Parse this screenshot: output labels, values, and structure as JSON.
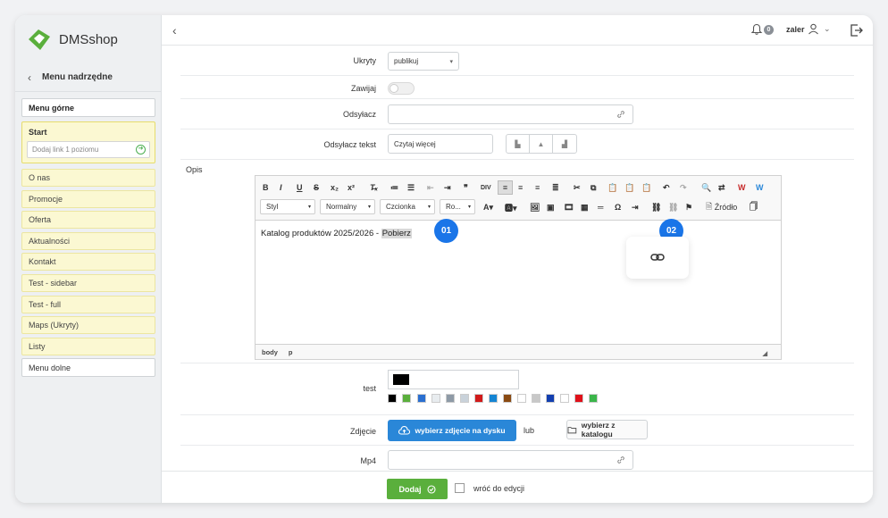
{
  "brand": {
    "name": "DMSshop"
  },
  "sidebar": {
    "parent_menu": "Menu nadrzędne",
    "top_menu": "Menu górne",
    "start": {
      "title": "Start",
      "placeholder": "Dodaj link 1 poziomu"
    },
    "items": [
      {
        "label": "O nas"
      },
      {
        "label": "Promocje"
      },
      {
        "label": "Oferta"
      },
      {
        "label": "Aktualności"
      },
      {
        "label": "Kontakt"
      },
      {
        "label": "Test - sidebar"
      },
      {
        "label": "Test - full"
      },
      {
        "label": "Maps (Ukryty)"
      },
      {
        "label": "Listy"
      }
    ],
    "bottom_menu": "Menu dolne"
  },
  "header": {
    "notifications": "0",
    "user": "zaler"
  },
  "form": {
    "hidden_label": "Ukryty",
    "hidden_value": "publikuj",
    "collapse_label": "Zawijaj",
    "link_label": "Odsyłacz",
    "link_value": "",
    "link_text_label": "Odsyłacz tekst",
    "link_text_value": "Czytaj więcej",
    "desc_label": "Opis",
    "test_label": "test",
    "image_label": "Zdjęcie",
    "upload_button": "wybierz zdjęcie na dysku",
    "or_text": "lub",
    "catalog_button": "wybierz z katalogu",
    "mp4_label": "Mp4",
    "mp4_value": ""
  },
  "editor": {
    "style_select": "Styl",
    "format_select": "Normalny",
    "font_select": "Czcionka",
    "size_select": "Ro...",
    "source_label": "Źródło",
    "content": "Katalog produktów 2025/2026 - ",
    "content_link": "Pobierz",
    "path": [
      "body",
      "p"
    ]
  },
  "badges": {
    "first": "01",
    "second": "02"
  },
  "colors": {
    "accent_blue": "#1a75e8",
    "brand_green": "#5aaf3c",
    "swatches": [
      "#000000",
      "#5aaf3c",
      "#2a6fd0",
      "#e8ecef",
      "#8e9aa6",
      "#c9d2da",
      "#d11a1a",
      "#1585d3",
      "#8a4a12",
      "#ffffff",
      "#c8c8c8",
      "#123fb0",
      "#ffffff",
      "#e0101a",
      "#3bb54a"
    ]
  },
  "footer": {
    "add_button": "Dodaj",
    "return_label": "wróć do edycji"
  }
}
